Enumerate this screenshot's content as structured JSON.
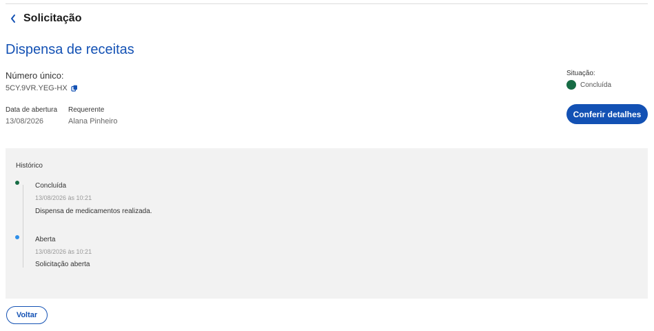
{
  "header": {
    "back_title": "Solicitação"
  },
  "request": {
    "title": "Dispensa de receitas",
    "number_label": "Número único:",
    "number_value": "5CY.9VR.YEG-HX",
    "opening_date_label": "Data de abertura",
    "opening_date_value": "13/08/2026",
    "requester_label": "Requerente",
    "requester_value": "Alana Pinheiro"
  },
  "status": {
    "label": "Situação:",
    "value": "Concluída",
    "color": "#176c45"
  },
  "actions": {
    "details_label": "Conferir detalhes",
    "back_label": "Voltar"
  },
  "history": {
    "title": "Histórico",
    "entries": [
      {
        "status": "Concluída",
        "timestamp": "13/08/2026 às 10:21",
        "description": "Dispensa de medicamentos realizada.",
        "color": "#176c45"
      },
      {
        "status": "Aberta",
        "timestamp": "13/08/2026 às 10:21",
        "description": "Solicitação aberta",
        "color": "#2e8fe9"
      }
    ]
  },
  "colors": {
    "primary": "#1351b4",
    "panel_bg": "#f2f2f2"
  },
  "icons": {
    "back": "chevron-left-icon",
    "copy": "copy-icon"
  }
}
